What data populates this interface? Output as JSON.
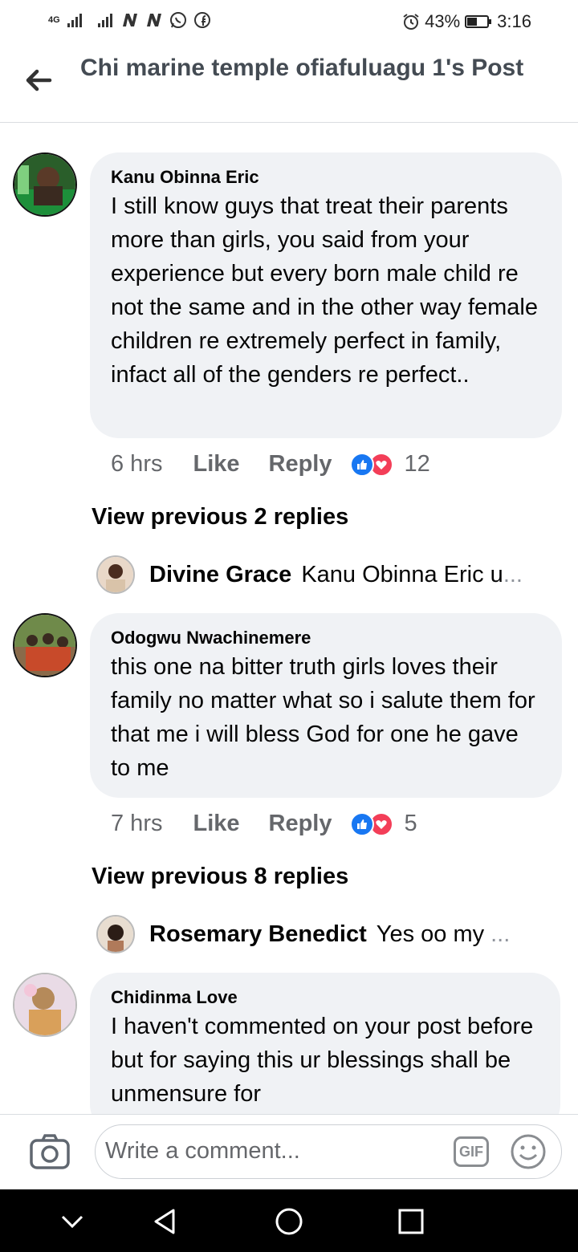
{
  "status_bar": {
    "network_label": "4G",
    "carrier_icons": [
      "signal-icon",
      "signal-icon",
      "n-icon",
      "n-icon",
      "whatsapp-icon",
      "facebook-icon"
    ],
    "battery_percent": "43%",
    "time": "3:16"
  },
  "header": {
    "title": "Chi marine temple ofiafuluagu 1's Post"
  },
  "comments": [
    {
      "author": "Kanu Obinna Eric",
      "text": "I still know guys that treat their parents more than girls, you said from your experience but every born male child re not the same and in the other way female children re extremely perfect in family, infact all of the genders  re perfect..",
      "time": "6 hrs",
      "like_label": "Like",
      "reply_label": "Reply",
      "reaction_count": "12",
      "view_previous": "View previous 2 replies",
      "latest_reply": {
        "author": "Divine Grace",
        "text": "Kanu Obinna Eric u",
        "ellipsis": "..."
      }
    },
    {
      "author": "Odogwu Nwachinemere",
      "text": "this one na bitter truth girls loves their family no matter what so i salute them for that me i will bless God for one he gave to me",
      "time": "7 hrs",
      "like_label": "Like",
      "reply_label": "Reply",
      "reaction_count": "5",
      "view_previous": "View previous 8 replies",
      "latest_reply": {
        "author": "Rosemary Benedict",
        "text": "Yes oo my",
        "ellipsis": "..."
      }
    },
    {
      "author": "Chidinma Love",
      "text": "I haven't commented on your post before but for saying this ur blessings shall be unmensure for"
    }
  ],
  "composer": {
    "placeholder": "Write a comment...",
    "gif_label": "GIF"
  },
  "colors": {
    "like_blue": "#1877f2",
    "love_red": "#f33e58",
    "bubble_bg": "#f0f2f5",
    "meta_gray": "#65676b"
  }
}
